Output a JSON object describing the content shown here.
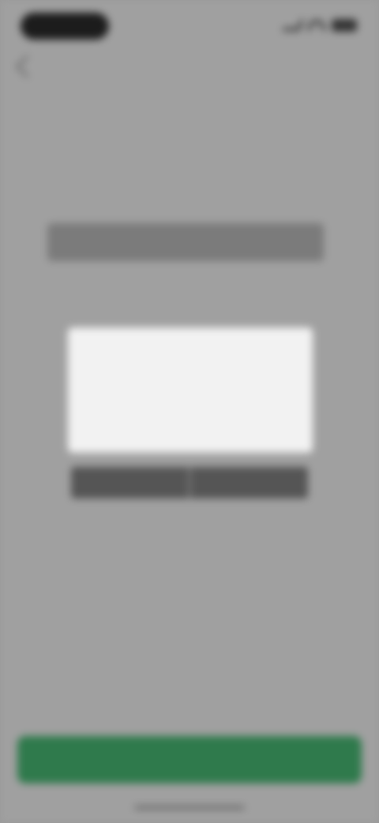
{
  "status_bar": {
    "time": "",
    "icons": [
      "signal-icon",
      "wifi-icon",
      "battery-icon"
    ]
  },
  "header": {
    "back_icon": "chevron-left-icon",
    "title": ""
  },
  "form": {
    "section_label": "",
    "field_hint": "",
    "row_left": "",
    "row_right": ""
  },
  "modal": {
    "title": "",
    "body": "",
    "cancel_label": "",
    "confirm_label": ""
  },
  "footer": {
    "primary_label": ""
  },
  "colors": {
    "overlay": "#9a9a9a",
    "primary_button": "#2f7a4c",
    "modal_bg": "#f2f2f2",
    "status_pill": "#1c1c1c"
  }
}
